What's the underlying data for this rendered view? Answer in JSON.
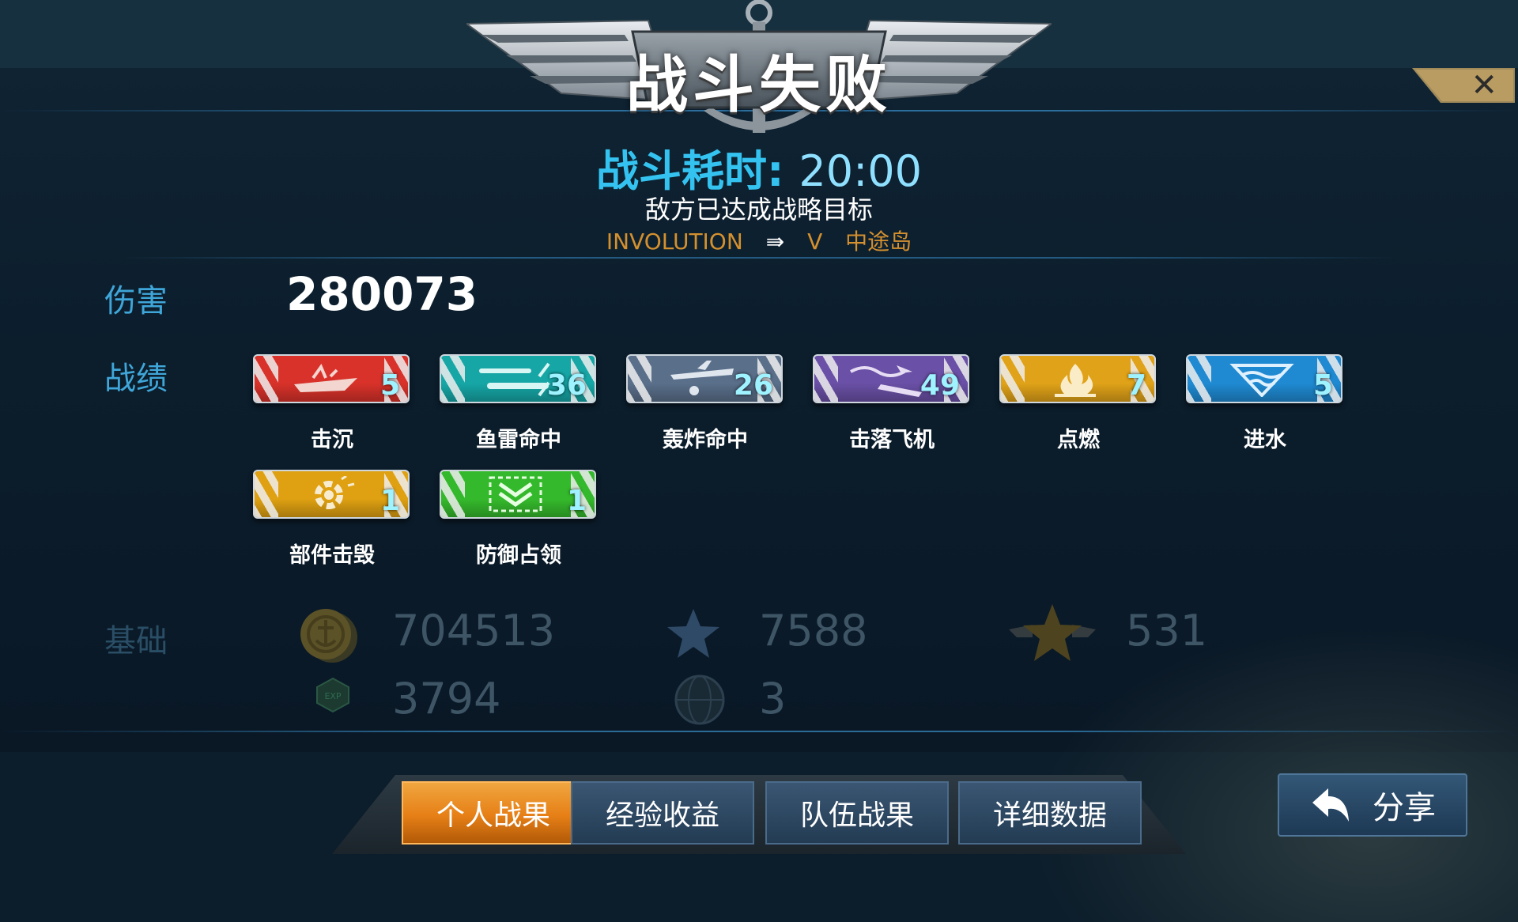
{
  "header": {
    "title": "战斗失败",
    "duration_label": "战斗耗时:",
    "duration_value": "20:00",
    "subtitle": "敌方已达成战略目标",
    "map_line": {
      "team": "INVOLUTION",
      "mode": "V",
      "map": "中途岛"
    }
  },
  "damage": {
    "label": "伤害",
    "value": "280073"
  },
  "record": {
    "label": "战绩",
    "badges": [
      {
        "label": "击沉",
        "count": "5",
        "color": "#d8322a",
        "icon": "ship-sinking-icon"
      },
      {
        "label": "鱼雷命中",
        "count": "36",
        "color": "#16a6a6",
        "icon": "torpedo-icon"
      },
      {
        "label": "轰炸命中",
        "count": "26",
        "color": "#5a6f8a",
        "icon": "bomber-icon"
      },
      {
        "label": "击落飞机",
        "count": "49",
        "color": "#6a50a6",
        "icon": "plane-shot-down-icon"
      },
      {
        "label": "点燃",
        "count": "7",
        "color": "#e0a218",
        "icon": "fire-icon"
      },
      {
        "label": "进水",
        "count": "5",
        "color": "#1f8ad2",
        "icon": "flooding-icon"
      },
      {
        "label": "部件击毁",
        "count": "1",
        "color": "#dfa112",
        "icon": "gear-broken-icon"
      },
      {
        "label": "防御占领",
        "count": "1",
        "color": "#35b92c",
        "icon": "chevron-down-icon"
      }
    ]
  },
  "base": {
    "label": "基础",
    "items": [
      {
        "icon": "coin-anchor-icon",
        "value": "704513"
      },
      {
        "icon": "star-icon",
        "value": "7588"
      },
      {
        "icon": "winged-star-icon",
        "value": "531"
      },
      {
        "icon": "exp-icon",
        "value": "3794"
      },
      {
        "icon": "globe-icon",
        "value": "3"
      }
    ]
  },
  "tabs": [
    {
      "label": "个人战果",
      "active": true
    },
    {
      "label": "经验收益",
      "active": false
    },
    {
      "label": "队伍战果",
      "active": false
    },
    {
      "label": "详细数据",
      "active": false
    }
  ],
  "share": {
    "label": "分享"
  },
  "colors": {
    "accent_blue": "#34c3f0",
    "label_blue": "#3fa6d9",
    "gold": "#d4902e",
    "active_tab": "#e67f16"
  }
}
